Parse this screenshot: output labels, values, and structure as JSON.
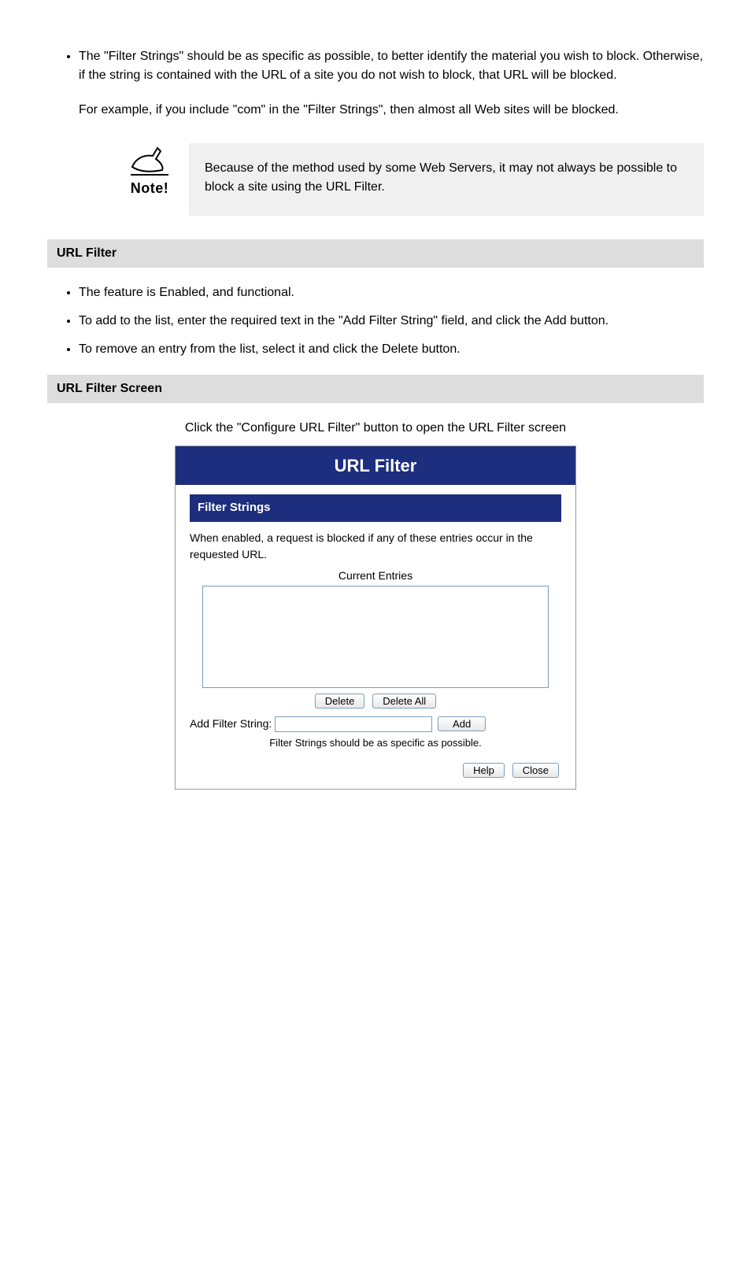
{
  "intro": {
    "bullet1": "The \"Filter Strings\" should be as specific as possible, to better identify the material you wish to block. Otherwise, if the string is contained with the URL of a site you do not wish to block, that URL will be blocked.",
    "para": "For example, if you include \"com\" in the \"Filter Strings\", then almost all Web sites will be blocked."
  },
  "note": {
    "text": "Because of the method used by some Web Servers, it may not always be possible to block a site using the URL Filter."
  },
  "bar1": "URL Filter",
  "list2": {
    "b1": "The feature is Enabled, and functional.",
    "b2": "To add to the list, enter the required text in the \"Add Filter String\" field, and click the Add button.",
    "b3": "To remove an entry from the list, select it and click the Delete button."
  },
  "bar2": "URL Filter Screen",
  "caption": "Click the \"Configure URL Filter\" button to open the URL Filter screen",
  "dialog": {
    "title": "URL Filter",
    "section": "Filter Strings",
    "desc": "When enabled, a request is blocked if any of these entries occur in the requested URL.",
    "entriesLabel": "Current Entries",
    "deleteBtn": "Delete",
    "deleteAllBtn": "Delete All",
    "addLabel": "Add Filter String:",
    "addBtn": "Add",
    "hint": "Filter Strings should be as specific as possible.",
    "helpBtn": "Help",
    "closeBtn": "Close"
  }
}
